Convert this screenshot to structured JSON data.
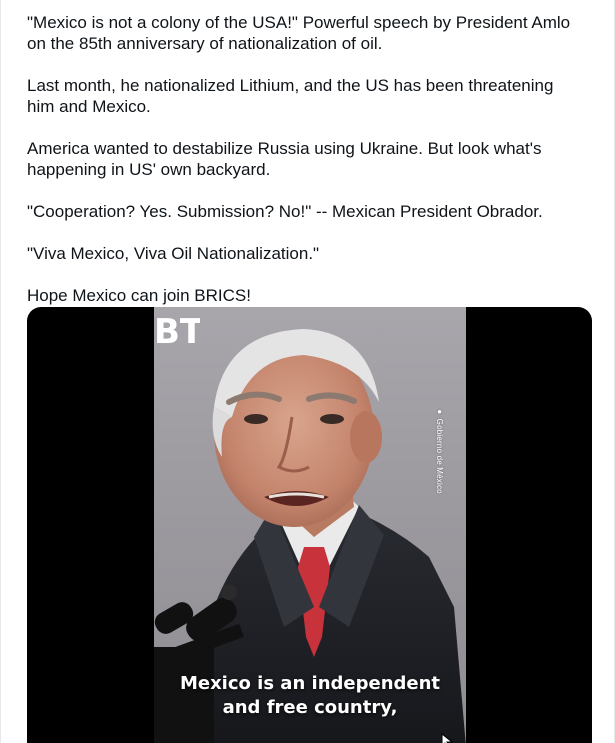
{
  "tweet": {
    "paragraphs": [
      "\"Mexico is not a colony of the USA!\" Powerful speech by President Amlo\non the 85th anniversary of nationalization of oil.",
      "Last month, he nationalized Lithium, and the US has been threatening\nhim and Mexico.",
      "America wanted to destabilize Russia using Ukraine. But look what's\nhappening in US' own backyard.",
      "\"Cooperation? Yes. Submission? No!\" -- Mexican President Obrador.",
      "\"Viva Mexico, Viva Oil Nationalization.\"",
      "Hope Mexico can join BRICS!"
    ]
  },
  "video": {
    "watermark_logo": "BT",
    "source_tag": "Gobierno de México",
    "subtitle_line1": "Mexico is an independent",
    "subtitle_line2": "and free country,"
  },
  "colors": {
    "text": "#0f1419",
    "media_bg": "#000000",
    "tie": "#c8323a"
  }
}
